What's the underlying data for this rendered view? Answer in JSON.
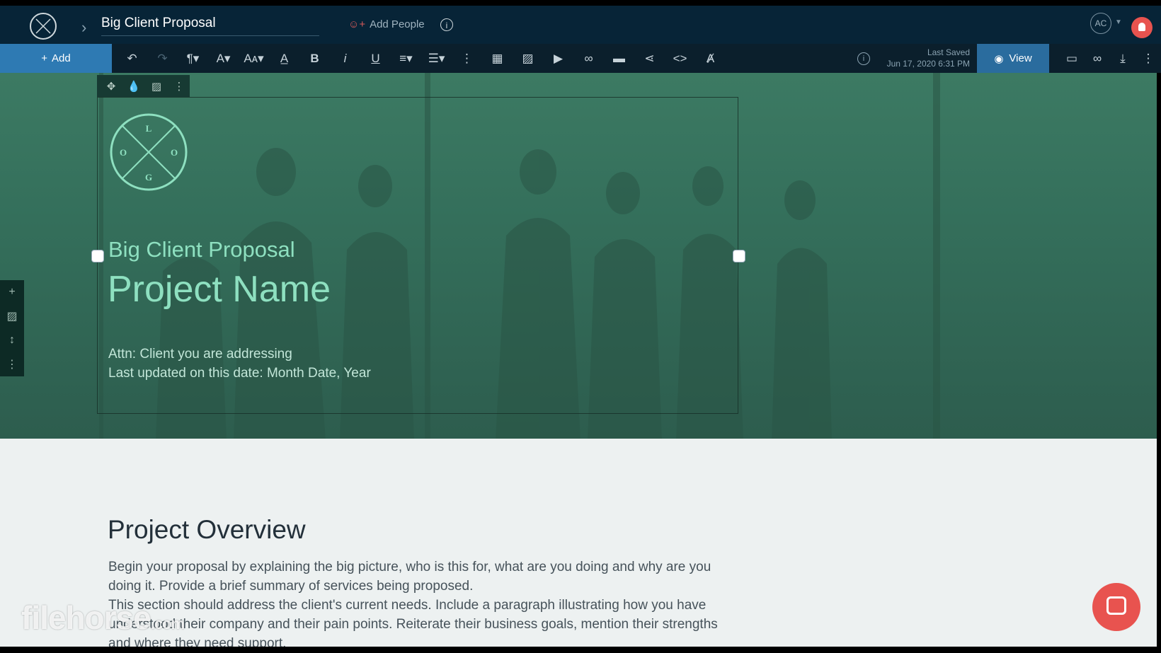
{
  "app": {
    "doc_title": "Big Client Proposal",
    "add_people_label": "Add People",
    "avatar_initials": "AC"
  },
  "toolbar": {
    "add_label": "Add",
    "last_saved_label": "Last Saved",
    "last_saved_time": "Jun 17, 2020 6:31 PM",
    "view_label": "View",
    "format_icons": [
      "undo-icon",
      "redo-icon",
      "paragraph-icon",
      "font-icon",
      "font-size-icon",
      "text-color-icon",
      "bold-icon",
      "italic-icon",
      "underline-icon",
      "align-icon",
      "line-spacing-icon",
      "more-vertical-icon",
      "table-icon",
      "image-icon",
      "video-icon",
      "link-icon",
      "button-icon",
      "share-icon",
      "code-icon",
      "clear-format-icon"
    ],
    "right_icons": [
      "comment-icon",
      "link-icon",
      "download-icon",
      "more-vertical-icon"
    ]
  },
  "hero": {
    "logo_letters": [
      "L",
      "O",
      "O",
      "G"
    ],
    "subtitle": "Big Client Proposal",
    "title": "Project Name",
    "attn": "Attn: Client you are addressing",
    "updated": "Last updated on this date: Month Date, Year",
    "colors": {
      "accent": "#8ee0c0",
      "background": "#3c7a63"
    }
  },
  "overview": {
    "title": "Project Overview",
    "para1": "Begin your proposal by explaining the big picture, who is this for, what are you doing and why are you doing it. Provide a brief summary of services being proposed.",
    "para2": "This section should address the client's current needs. Include a paragraph illustrating how you have understood their company and their pain points. Reiterate their business goals, mention their strengths and where they need support."
  },
  "watermark": {
    "name": "filehorse",
    "suffix": ".com"
  }
}
